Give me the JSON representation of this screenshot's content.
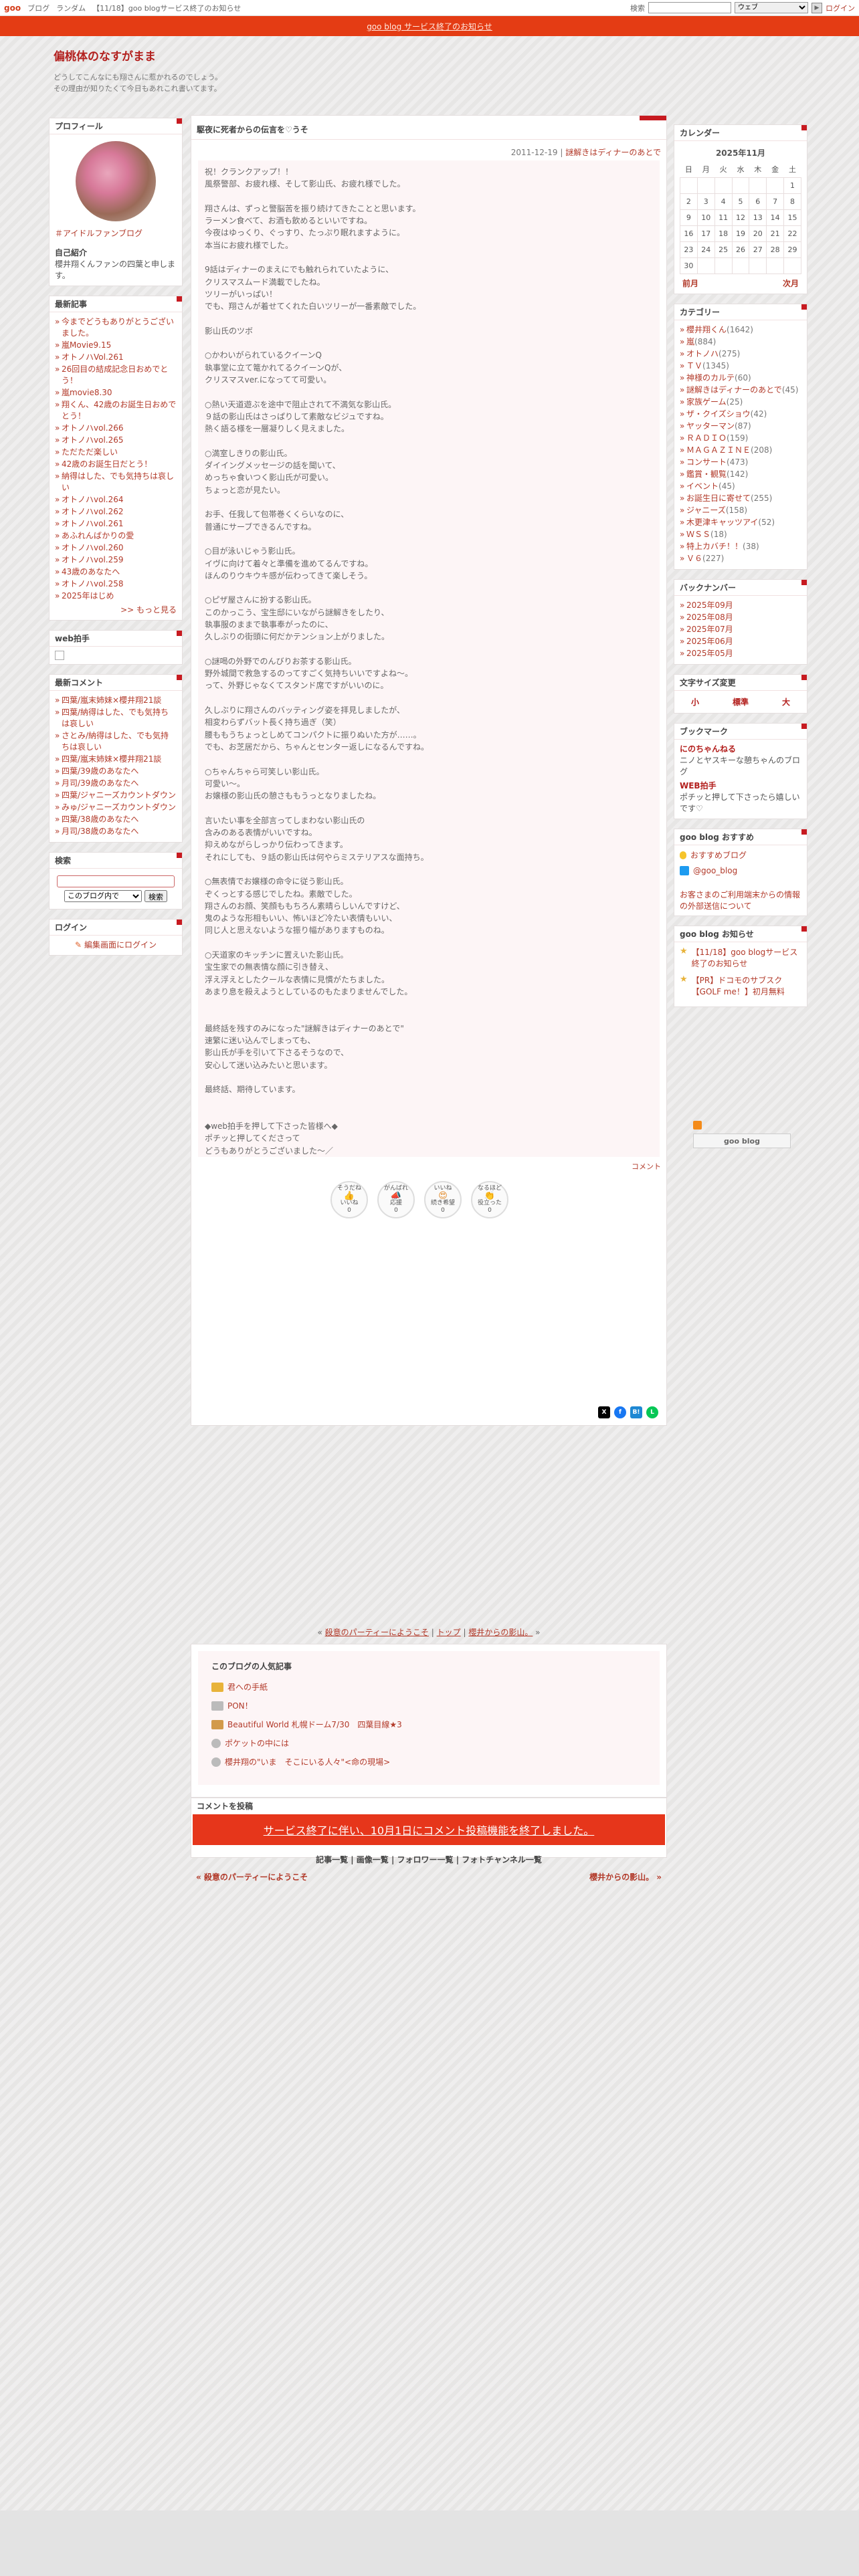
{
  "topbar": {
    "logo": "goo",
    "links": [
      "ブログ",
      "ランダム",
      "【11/18】goo blogサービス終了のお知らせ"
    ],
    "search_label": "検索",
    "web_option": "ウェブ",
    "go": "▶",
    "login": "ログイン"
  },
  "notice": {
    "text": "goo blog サービス終了のお知らせ"
  },
  "header": {
    "title": "偏桃体のなすがまま",
    "desc1": "どうしてこんなにも翔さんに惹かれるのでしょう。",
    "desc2": "その理由が知りたくて今日もあれこれ書いてます。"
  },
  "profile": {
    "heading": "プロフィール",
    "link": "＃アイドルファンブログ",
    "intro_label": "自己紹介",
    "intro": "櫻井翔くんファンの四葉と申します。"
  },
  "recent": {
    "heading": "最新記事",
    "items": [
      "今までどうもありがとうございました。",
      "嵐Movie9.15",
      "オトノハVol.261",
      "26回目の結成記念日おめでとう！",
      "嵐movie8.30",
      "翔くん、42歳のお誕生日おめでとう！",
      "オトノハvol.266",
      "オトノハvol.265",
      "ただただ楽しい",
      "42歳のお誕生日だとう！",
      "納得はした、でも気持ちは哀しい",
      "オトノハvol.264",
      "オトノハvol.262",
      "オトノハvol.261",
      "あふれんばかりの愛",
      "オトノハvol.260",
      "オトノハvol.259",
      "43歳のあなたへ",
      "オトノハvol.258",
      "2025年はじめ"
    ],
    "more": ">> もっと見る"
  },
  "web_clap": {
    "heading": "web拍手"
  },
  "comments": {
    "heading": "最新コメント",
    "items": [
      "四葉/嵐末姉妹×櫻井翔21談",
      "四葉/納得はした、でも気持ちは哀しい",
      "さとみ/納得はした、でも気持ちは哀しい",
      "四葉/嵐末姉妹×櫻井翔21談",
      "四葉/39歳のあなたへ",
      "月司/39歳のあなたへ",
      "四葉/ジャニーズカウントダウン",
      "みゅ/ジャニーズカウントダウン",
      "四葉/38歳のあなたへ",
      "月司/38歳のあなたへ"
    ]
  },
  "search": {
    "heading": "検索",
    "scope": "このブログ内で",
    "button": "検索"
  },
  "login": {
    "heading": "ログイン",
    "link": "編集画面にログイン"
  },
  "post": {
    "title": "駆夜に死者からの伝言を♡うそ",
    "date": "2011-12-19",
    "category": "謎解きはディナーのあとで",
    "separator": " | ",
    "body": [
      "祝！クランクアップ！！",
      "風祭警部、お疲れ様、そして影山氏、お疲れ様でした。",
      "",
      "翔さんは、ずっと警脳苦を振り続けてきたことと思います。",
      "ラーメン食べて、お酒も飲めるといいですね。",
      "今夜はゆっくり、ぐっすり、たっぷり眠れますように。",
      "本当にお疲れ様でした。",
      "",
      "9話はディナーのまえにでも触れられていたように、",
      "クリスマスムード満載でしたね。",
      "ツリーがいっぱい！",
      "でも、翔さんが着せてくれた白いツリーが一番素敵でした。",
      "",
      "影山氏のツボ",
      "",
      "○かわいがられているクイーンQ",
      "執事堂に立て篭かれてるクイーンQが、",
      "クリスマスver.になってて可愛い。",
      "",
      "○熱い天道遊ぶを途中で阻止されて不満気な影山氏。",
      "９話の影山氏はさっぱりして素敵なビジュですね。",
      "熱く語る様を一層凝りしく見えました。",
      "",
      "○満室しきりの影山氏。",
      "ダイイングメッセージの話を聞いて、",
      "めっちゃ食いつく影山氏が可愛い。",
      "ちょっと恋が見たい。",
      "",
      "お手、任我して包帯巻くくらいなのに、",
      "普通にサーブできるんですね。",
      "",
      "○目が泳いじゃう影山氏。",
      "イヴに向けて着々と準備を進めてるんですね。",
      "ほんのりウキウキ感が伝わってきて楽しそう。",
      "",
      "○ピザ屋さんに扮する影山氏。",
      "このかっこう、宝生邸にいながら謎解きをしたり、",
      "執事服のままで執事奉がったのに、",
      "久しぶりの街頭に何だかテンション上がりました。",
      "",
      "○謎喝の外野でのんびりお茶する影山氏。",
      "野外城間で救急するのってすごく気持ちいいですよね〜。",
      "って、外野じゃなくてスタンド席ですがいいのに。",
      "",
      "久しぶりに翔さんのバッティング姿を拝見しましたが、",
      "相変わらずバット長く持ち過ぎ（笑）",
      "腰ももうちょっとしめてコンパクトに振りぬいた方が……。",
      "でも、お芝居だから、ちゃんとセンター返しになるんですね。",
      "",
      "○ちゃんちゃら可笑しい影山氏。",
      "可愛い〜。",
      "お嬢様の影山氏の憩さももうっとなりましたね。",
      "",
      "言いたい事を全部言ってしまわない影山氏の",
      "含みのある表情がいいですね。",
      "抑えめながらしっかり伝わってきます。",
      "それにしても、９話の影山氏は何やらミステリアスな面持ち。",
      "",
      "○無表情でお嬢様の命令に従う影山氏。",
      "ぞくっとする感じでしたね。素敵でした。",
      "翔さんのお顔、笑顔ももちろん素晴らしいんですけど、",
      "鬼のような形相もいい、怖いほど冷たい表情もいい、",
      "同じ人と思えないような振り幅がありますものね。",
      "",
      "○天道家のキッチンに置えいた影山氏。",
      "宝生家での無表情な顔に引き替え、",
      "浮え浮えとしたクールな表情に見慣がたちました。",
      "あまり息を殺えようとしているのもたまりませんでした。",
      "",
      "",
      "最終話を残すのみになった\"謎解きはディナーのあとで\"",
      "速繁に迷い込んでしまっても、",
      "影山氏が手を引いて下さるそうなので、",
      "安心して迷い込みたいと思います。",
      "",
      "最終話、期待しています。",
      "",
      "",
      "◆web拍手を押して下さった皆様へ◆",
      "ポチッと押してくださって",
      "どうもありがとうございました〜／"
    ],
    "comment_link": "コメント",
    "reactions": [
      {
        "top": "そうだね",
        "label": "いいね",
        "count": "0",
        "emoji": "👍"
      },
      {
        "top": "がんばれ",
        "label": "応援",
        "count": "0",
        "emoji": "📣"
      },
      {
        "top": "いいね",
        "label": "続き希望",
        "count": "0",
        "emoji": "😍"
      },
      {
        "top": "なるほど",
        "label": "役立った",
        "count": "0",
        "emoji": "👏"
      }
    ],
    "share": [
      "X",
      "f",
      "B!",
      "L"
    ]
  },
  "navline": {
    "prev": "殺意のパーティーにようこそ",
    "top": "トップ",
    "next": "櫻井からの影山。",
    "lt": "« ",
    "gt": " »",
    "sep": " | "
  },
  "popular": {
    "heading": "このブログの人気記事",
    "items": [
      "君への手紙",
      "PON！",
      "Beautiful World 札幌ドーム7/30　四葉目線★3",
      "ポケットの中には",
      "櫻井翔の\"いま　そこにいる人々\"<命の現場>"
    ]
  },
  "comment_post": {
    "heading": "コメントを投稿",
    "notice": "サービス終了に伴い、10月1日にコメント投稿機能を終了しました。"
  },
  "bottom_links": {
    "text": "記事一覧 | 画像一覧 | フォロワー一覧 | フォトチャンネル一覧"
  },
  "bottom_nav": {
    "prev": "« 殺意のパーティーにようこそ",
    "next": "櫻井からの影山。 »"
  },
  "calendar": {
    "heading": "カレンダー",
    "caption": "2025年11月",
    "weekdays": [
      "日",
      "月",
      "火",
      "水",
      "木",
      "金",
      "土"
    ],
    "rows": [
      [
        "",
        "",
        "",
        "",
        "",
        "",
        "1"
      ],
      [
        "2",
        "3",
        "4",
        "5",
        "6",
        "7",
        "8"
      ],
      [
        "9",
        "10",
        "11",
        "12",
        "13",
        "14",
        "15"
      ],
      [
        "16",
        "17",
        "18",
        "19",
        "20",
        "21",
        "22"
      ],
      [
        "23",
        "24",
        "25",
        "26",
        "27",
        "28",
        "29"
      ],
      [
        "30",
        "",
        "",
        "",
        "",
        "",
        ""
      ]
    ],
    "prev": "前月",
    "next": "次月"
  },
  "categories": {
    "heading": "カテゴリー",
    "items": [
      {
        "name": "櫻井翔くん",
        "count": "(1642)"
      },
      {
        "name": "嵐",
        "count": "(884)"
      },
      {
        "name": "オトノハ",
        "count": "(275)"
      },
      {
        "name": "ＴＶ",
        "count": "(1345)"
      },
      {
        "name": "神様のカルテ",
        "count": "(60)"
      },
      {
        "name": "謎解きはディナーのあとで",
        "count": "(45)"
      },
      {
        "name": "家族ゲーム",
        "count": "(25)"
      },
      {
        "name": "ザ・クイズショウ",
        "count": "(42)"
      },
      {
        "name": "ヤッターマン",
        "count": "(87)"
      },
      {
        "name": "ＲＡＤＩＯ",
        "count": "(159)"
      },
      {
        "name": "ＭＡＧＡＺＩＮＥ",
        "count": "(208)"
      },
      {
        "name": "コンサート",
        "count": "(473)"
      },
      {
        "name": "鑑賞・観覧",
        "count": "(142)"
      },
      {
        "name": "イベント",
        "count": "(45)"
      },
      {
        "name": "お誕生日に寄せて",
        "count": "(255)"
      },
      {
        "name": "ジャニーズ",
        "count": "(158)"
      },
      {
        "name": "木更津キャッツアイ",
        "count": "(52)"
      },
      {
        "name": "ＷＳＳ",
        "count": "(18)"
      },
      {
        "name": "特上カバチ！！",
        "count": "(38)"
      },
      {
        "name": "Ｖ６",
        "count": "(227)"
      }
    ]
  },
  "backnumber": {
    "heading": "バックナンバー",
    "items": [
      "2025年09月",
      "2025年08月",
      "2025年07月",
      "2025年06月",
      "2025年05月"
    ]
  },
  "fontsize": {
    "heading": "文字サイズ変更",
    "small": "小",
    "normal": "標準",
    "large": "大"
  },
  "bookmark": {
    "heading": "ブックマーク",
    "items": [
      {
        "name": "にのちゃんねる",
        "desc": "ニノとヤスキーな憩ちゃんのブログ"
      },
      {
        "name": "WEB拍手",
        "desc": "ポチッと押して下さったら嬉しいです♡"
      }
    ]
  },
  "goo_recommend": {
    "heading": "goo blog おすすめ",
    "items": [
      "おすすめブログ",
      "@goo_blog"
    ],
    "notice": "お客さまのご利用端末からの情報の外部送信について"
  },
  "goo_news": {
    "heading": "goo blog お知らせ",
    "items": [
      "【11/18】goo blogサービス終了のお知らせ",
      "【PR】ドコモのサブスク【GOLF me！】初月無料"
    ]
  },
  "footer_logo": {
    "text": "goo blog"
  }
}
